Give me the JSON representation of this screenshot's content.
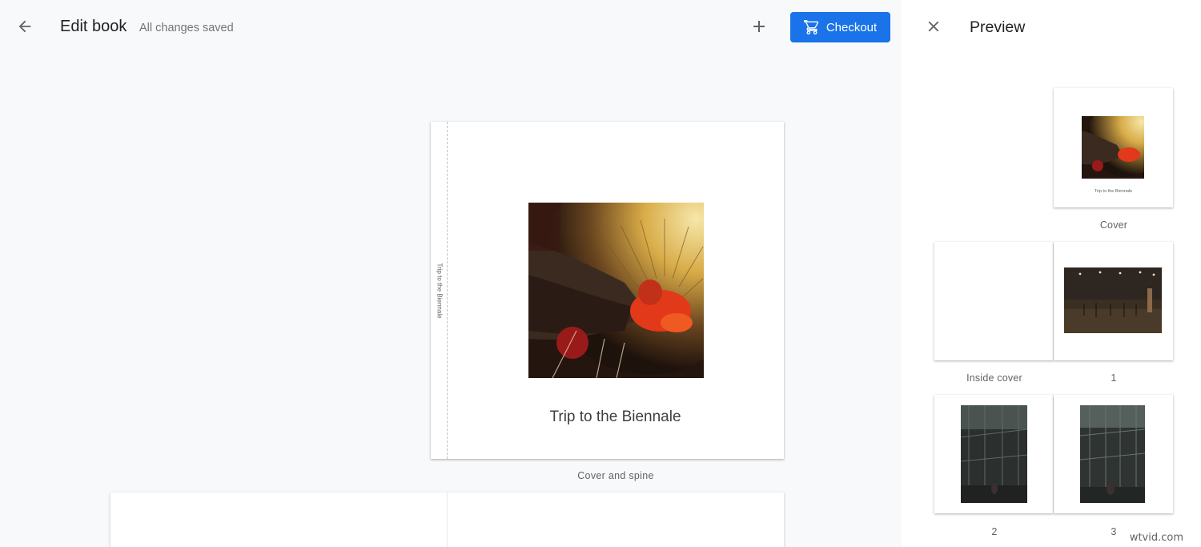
{
  "header": {
    "title": "Edit book",
    "status": "All changes saved",
    "checkout_label": "Checkout"
  },
  "icons": {
    "back": "arrow-left-icon",
    "add": "plus-icon",
    "cart": "cart-icon",
    "close": "close-icon"
  },
  "colors": {
    "accent": "#1a73e8",
    "editor_bg": "#f8f9fa",
    "panel_bg": "#ffffff"
  },
  "cover": {
    "spine_text": "Trip to the Biennale",
    "title": "Trip to the Biennale",
    "caption": "Cover and spine"
  },
  "preview": {
    "title": "Preview",
    "cover_title": "Trip to the Biennale",
    "labels": {
      "cover": "Cover",
      "inside_cover": "Inside cover",
      "page1": "1",
      "page2": "2",
      "page3": "3"
    }
  },
  "watermark": "wtvid.com"
}
